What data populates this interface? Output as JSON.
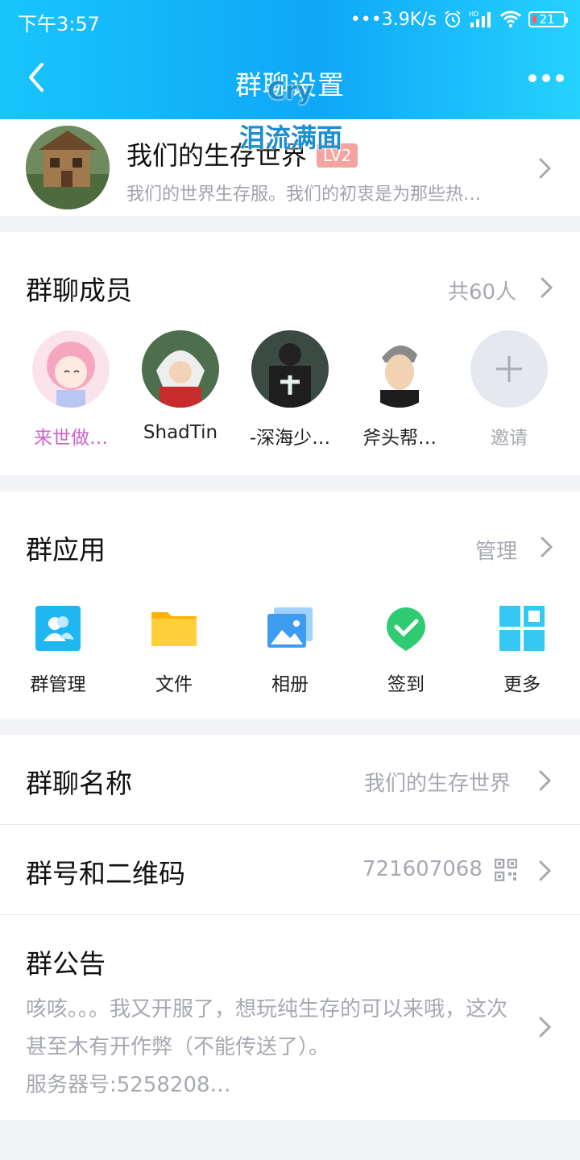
{
  "status_bar": {
    "time": "下午3:57",
    "network_speed": "•••3.9K/s",
    "battery": "21"
  },
  "header": {
    "title": "群聊设置"
  },
  "watermark": {
    "line1": "Cry",
    "line2": "泪流满面"
  },
  "group": {
    "name": "我们的生存世界",
    "level": "LV2",
    "description": "我们的世界生存服。我们的初衷是为那些热…"
  },
  "members": {
    "title": "群聊成员",
    "count_label": "共60人",
    "items": [
      {
        "name": "来世做…",
        "color": "#c965c9"
      },
      {
        "name": "ShadTin",
        "color": "#222222"
      },
      {
        "name": "-深海少…",
        "color": "#222222"
      },
      {
        "name": "斧头帮…",
        "color": "#222222"
      }
    ],
    "invite_label": "邀请"
  },
  "apps": {
    "title": "群应用",
    "manage_label": "管理",
    "items": [
      {
        "label": "群管理",
        "icon": "group-manage-icon"
      },
      {
        "label": "文件",
        "icon": "folder-icon"
      },
      {
        "label": "相册",
        "icon": "album-icon"
      },
      {
        "label": "签到",
        "icon": "checkin-icon"
      },
      {
        "label": "更多",
        "icon": "grid-more-icon"
      }
    ]
  },
  "info": {
    "name_label": "群聊名称",
    "name_value": "我们的生存世界",
    "id_label": "群号和二维码",
    "id_value": "721607068",
    "notice_label": "群公告",
    "notice_line1": "咳咳。。。我又开服了，想玩纯生存的可以来哦，这次",
    "notice_line2": "甚至木有开作弊（不能传送了）。",
    "notice_line3": "服务器号:5258208…"
  },
  "colors": {
    "header_start": "#18c5fb",
    "header_end": "#0fa7f7",
    "accent": "#12b7f5"
  }
}
